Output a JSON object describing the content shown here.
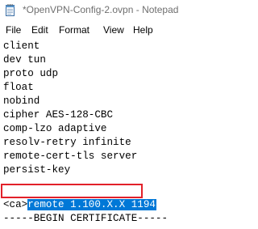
{
  "window": {
    "title": "*OpenVPN-Config-2.ovpn - Notepad",
    "icon": "notepad-icon"
  },
  "menu": {
    "items": [
      "File",
      "Edit",
      "Format",
      "View",
      "Help"
    ]
  },
  "editor": {
    "lines": [
      "client",
      "dev tun",
      "proto udp",
      "float",
      "nobind",
      "cipher AES-128-CBC",
      "comp-lzo adaptive",
      "resolv-retry infinite",
      "remote-cert-tls server",
      "persist-key",
      "remote 1.100.X.X 1194",
      "<ca>",
      "-----BEGIN CERTIFICATE-----"
    ],
    "selected_line_index": 10,
    "selection_color": "#0078d7",
    "highlight_box_color": "#e2212a"
  }
}
